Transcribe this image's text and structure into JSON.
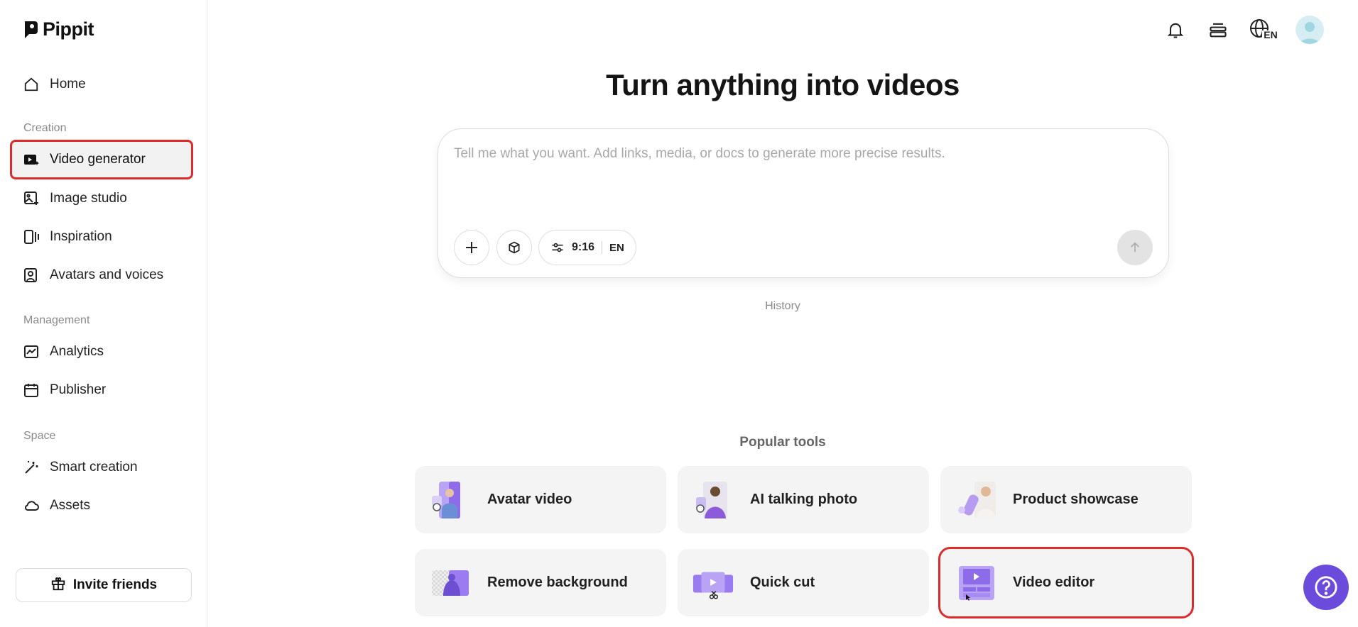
{
  "app": {
    "name": "Pippit"
  },
  "sidebar": {
    "home": {
      "label": "Home",
      "icon": "home-icon"
    },
    "sections": [
      {
        "title": "Creation"
      },
      {
        "title": "Management"
      },
      {
        "title": "Space"
      }
    ],
    "items": [
      {
        "label": "Video generator",
        "icon": "video-generator-icon",
        "active": true
      },
      {
        "label": "Image studio",
        "icon": "image-studio-icon"
      },
      {
        "label": "Inspiration",
        "icon": "inspiration-icon"
      },
      {
        "label": "Avatars and voices",
        "icon": "avatar-voice-icon"
      },
      {
        "label": "Analytics",
        "icon": "analytics-icon"
      },
      {
        "label": "Publisher",
        "icon": "calendar-icon"
      },
      {
        "label": "Smart creation",
        "icon": "magic-wand-icon"
      },
      {
        "label": "Assets",
        "icon": "cloud-icon"
      }
    ],
    "invite_label": "Invite friends"
  },
  "topbar": {
    "icons": [
      "bell-icon",
      "layers-icon",
      "globe-language-icon",
      "user-avatar"
    ],
    "language": "EN"
  },
  "main": {
    "headline": "Turn anything into videos",
    "prompt": {
      "placeholder": "Tell me what you want. Add links, media, or docs to generate more precise results.",
      "value": "",
      "aspect_ratio": "9:16",
      "language": "EN"
    },
    "history_label": "History",
    "popular_title": "Popular tools",
    "tools": [
      {
        "label": "Avatar video"
      },
      {
        "label": "AI talking photo"
      },
      {
        "label": "Product showcase"
      },
      {
        "label": "Remove background"
      },
      {
        "label": "Quick cut"
      },
      {
        "label": "Video editor",
        "highlighted": true
      }
    ]
  },
  "colors": {
    "accent": "#6a4bdc",
    "highlight_border": "#dc2b2b",
    "card_bg": "#f4f4f4",
    "thumb_purple": "#9b7cf0"
  }
}
